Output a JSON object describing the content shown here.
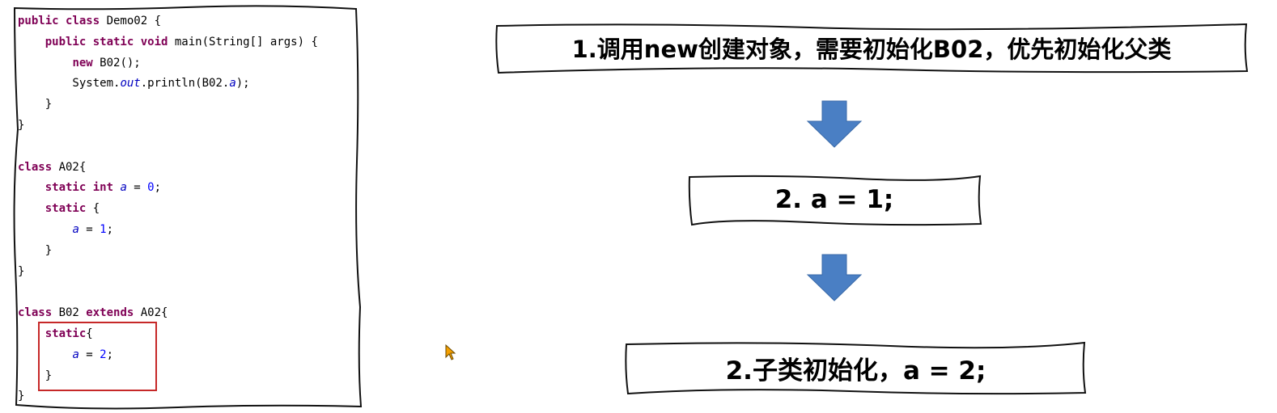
{
  "code_lines": [
    [
      {
        "t": "public class ",
        "c": "kw"
      },
      {
        "t": "Demo02 {",
        "c": ""
      }
    ],
    [
      {
        "t": "    ",
        "c": ""
      },
      {
        "t": "public static void ",
        "c": "kw"
      },
      {
        "t": "main(String[] args) {",
        "c": ""
      }
    ],
    [
      {
        "t": "        ",
        "c": ""
      },
      {
        "t": "new ",
        "c": "kw"
      },
      {
        "t": "B02();",
        "c": ""
      }
    ],
    [
      {
        "t": "        System.",
        "c": ""
      },
      {
        "t": "out",
        "c": "fld"
      },
      {
        "t": ".println(B02.",
        "c": ""
      },
      {
        "t": "a",
        "c": "fld"
      },
      {
        "t": ");",
        "c": ""
      }
    ],
    [
      {
        "t": "    }",
        "c": ""
      }
    ],
    [
      {
        "t": "}",
        "c": ""
      }
    ],
    [
      {
        "t": "",
        "c": ""
      }
    ],
    [
      {
        "t": "class ",
        "c": "kw"
      },
      {
        "t": "A02{",
        "c": ""
      }
    ],
    [
      {
        "t": "    ",
        "c": ""
      },
      {
        "t": "static int ",
        "c": "kw"
      },
      {
        "t": "a",
        "c": "fld"
      },
      {
        "t": " = ",
        "c": ""
      },
      {
        "t": "0",
        "c": "num"
      },
      {
        "t": ";",
        "c": ""
      }
    ],
    [
      {
        "t": "    ",
        "c": ""
      },
      {
        "t": "static ",
        "c": "kw"
      },
      {
        "t": "{",
        "c": ""
      }
    ],
    [
      {
        "t": "        ",
        "c": ""
      },
      {
        "t": "a",
        "c": "fld"
      },
      {
        "t": " = ",
        "c": ""
      },
      {
        "t": "1",
        "c": "num"
      },
      {
        "t": ";",
        "c": ""
      }
    ],
    [
      {
        "t": "    }",
        "c": ""
      }
    ],
    [
      {
        "t": "}",
        "c": ""
      }
    ],
    [
      {
        "t": "",
        "c": ""
      }
    ],
    [
      {
        "t": "class ",
        "c": "kw"
      },
      {
        "t": "B02 ",
        "c": ""
      },
      {
        "t": "extends ",
        "c": "kw"
      },
      {
        "t": "A02{",
        "c": ""
      }
    ],
    [
      {
        "t": "    ",
        "c": ""
      },
      {
        "t": "static",
        "c": "kw"
      },
      {
        "t": "{",
        "c": ""
      }
    ],
    [
      {
        "t": "        ",
        "c": ""
      },
      {
        "t": "a",
        "c": "fld"
      },
      {
        "t": " = ",
        "c": ""
      },
      {
        "t": "2",
        "c": "num"
      },
      {
        "t": ";",
        "c": ""
      }
    ],
    [
      {
        "t": "    }",
        "c": ""
      }
    ],
    [
      {
        "t": "}",
        "c": ""
      }
    ]
  ],
  "steps": {
    "step1": "1.调用new创建对象，需要初始化B02，优先初始化父类",
    "step2": "2. a = 1;",
    "step3": "2.子类初始化，a = 2;"
  },
  "colors": {
    "arrow": "#4a7fc4",
    "highlight": "#c62828",
    "keyword": "#7f0055",
    "field": "#0000c0",
    "number": "#0000ff",
    "cursor": "#f5a000"
  }
}
